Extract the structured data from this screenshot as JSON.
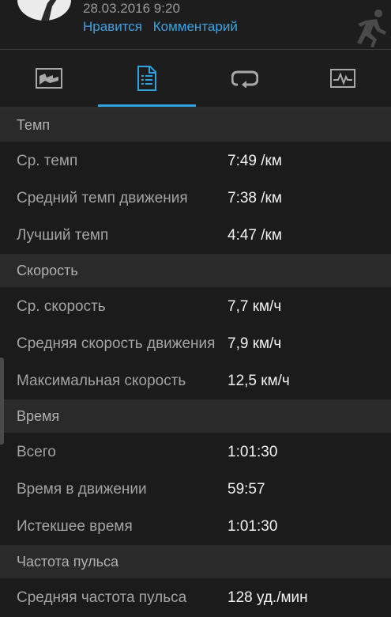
{
  "header": {
    "date": "28.03.2016 9:20",
    "like_label": "Нравится",
    "comment_label": "Комментарий",
    "activity_icon": "running-person-icon"
  },
  "tabs": [
    {
      "icon": "map-icon",
      "selected": false
    },
    {
      "icon": "details-document-icon",
      "selected": true
    },
    {
      "icon": "laps-loop-icon",
      "selected": false
    },
    {
      "icon": "chart-pulse-icon",
      "selected": false
    }
  ],
  "colors": {
    "accent": "#2ea3e0",
    "link": "#3fa3e3",
    "background": "#1b1b1b",
    "section_bg": "#2a2a2a"
  },
  "sections": [
    {
      "title": "Темп",
      "rows": [
        {
          "label": "Ср. темп",
          "value": "7:49 /км"
        },
        {
          "label": "Средний темп движения",
          "value": "7:38 /км"
        },
        {
          "label": "Лучший темп",
          "value": "4:47 /км"
        }
      ]
    },
    {
      "title": "Скорость",
      "rows": [
        {
          "label": "Ср. скорость",
          "value": "7,7 км/ч"
        },
        {
          "label": "Средняя скорость движения",
          "value": "7,9 км/ч"
        },
        {
          "label": "Максимальная скорость",
          "value": "12,5 км/ч"
        }
      ]
    },
    {
      "title": "Время",
      "rows": [
        {
          "label": "Всего",
          "value": "1:01:30"
        },
        {
          "label": "Время в движении",
          "value": "59:57"
        },
        {
          "label": "Истекшее время",
          "value": "1:01:30"
        }
      ]
    },
    {
      "title": "Частота пульса",
      "rows": [
        {
          "label": "Средняя частота пульса",
          "value": "128 уд./мин"
        }
      ]
    }
  ]
}
